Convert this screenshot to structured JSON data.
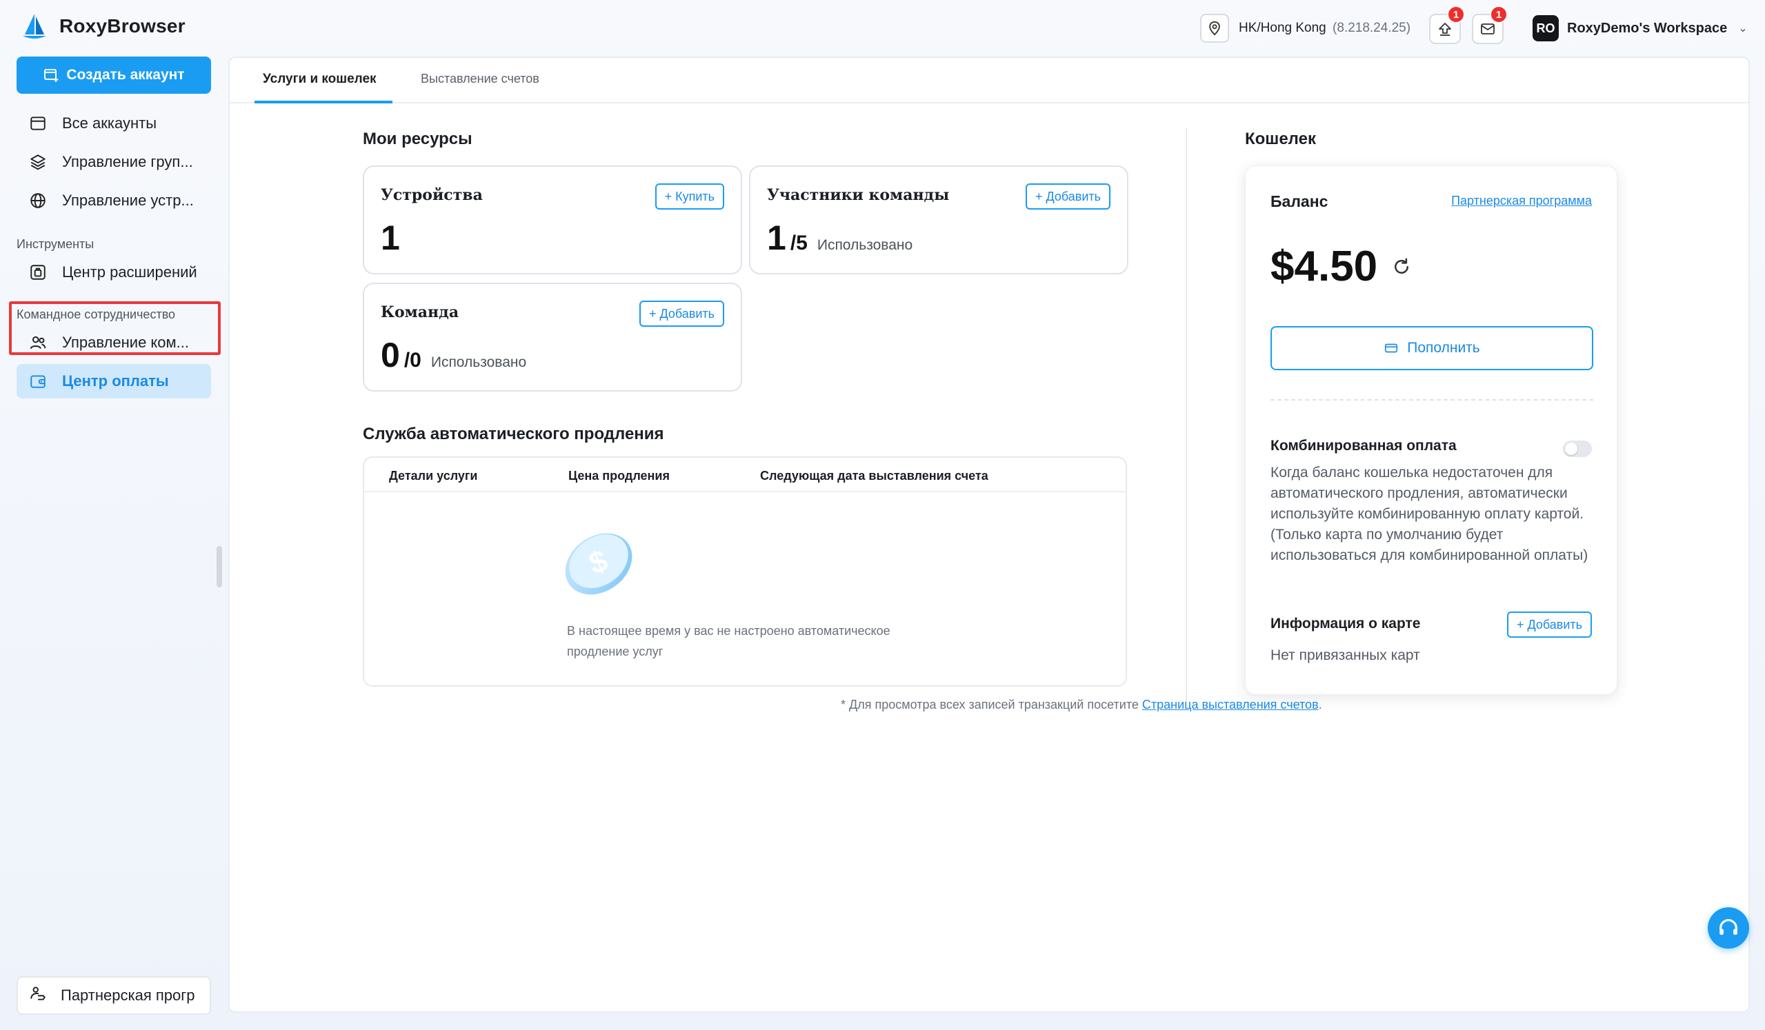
{
  "app": {
    "name": "RoxyBrowser"
  },
  "header": {
    "location": "HK/Hong Kong",
    "ip": "(8.218.24.25)",
    "upload_badge": "1",
    "mail_badge": "1",
    "workspace_initials": "RO",
    "workspace_name": "RoxyDemo's Workspace"
  },
  "sidebar": {
    "create_button": "Создать аккаунт",
    "items": [
      {
        "label": "Все аккаунты",
        "icon": "browser-window-icon"
      },
      {
        "label": "Управление груп...",
        "icon": "layers-icon"
      },
      {
        "label": "Управление устр...",
        "icon": "globe-icon"
      }
    ],
    "tools_section": "Инструменты",
    "tools_items": [
      {
        "label": "Центр расширений",
        "icon": "extension-icon"
      }
    ],
    "team_section": "Командное сотрудничество",
    "team_items": [
      {
        "label": "Управление ком...",
        "icon": "team-icon"
      },
      {
        "label": "Центр оплаты",
        "icon": "wallet-icon",
        "active": true
      }
    ],
    "partner": "Партнерская прогр"
  },
  "tabs": [
    {
      "label": "Услуги и кошелек",
      "active": true
    },
    {
      "label": "Выставление счетов",
      "active": false
    }
  ],
  "resources": {
    "title": "Мои ресурсы",
    "devices": {
      "label": "Устройства",
      "button": "+ Купить",
      "value": "1"
    },
    "members": {
      "label": "Участники команды",
      "button": "+ Добавить",
      "used": "1",
      "total": "/5",
      "suffix": "Использовано"
    },
    "team": {
      "label": "Команда",
      "button": "+ Добавить",
      "used": "0",
      "total": "/0",
      "suffix": "Использовано"
    }
  },
  "auto_renew": {
    "title": "Служба автоматического продления",
    "columns": [
      "Детали услуги",
      "Цена продления",
      "Следующая дата выставления счета"
    ],
    "empty_text": "В настоящее время у вас не настроено автоматическое продление услуг",
    "footnote_prefix": "* Для просмотра всех записей транзакций посетите",
    "footnote_link": "Страница выставления счетов",
    "footnote_suffix": "."
  },
  "wallet": {
    "title": "Кошелек",
    "balance_label": "Баланс",
    "partner_link": "Партнерская программа",
    "amount": "$4.50",
    "topup_button": "Пополнить",
    "combined_title": "Комбинированная оплата",
    "combined_enabled": false,
    "combined_desc": "Когда баланс кошелька недостаточен для автоматического продления, автоматически используйте комбинированную оплату картой. (Только карта по умолчанию будет использоваться для комбинированной оплаты)",
    "card_info_title": "Информация о карте",
    "card_add_button": "+ Добавить",
    "no_cards": "Нет привязанных карт"
  },
  "colors": {
    "accent": "#1a9cf2",
    "active_bg": "#cfe8fb",
    "highlight": "#e8393c",
    "badge": "#ef2d2d"
  }
}
